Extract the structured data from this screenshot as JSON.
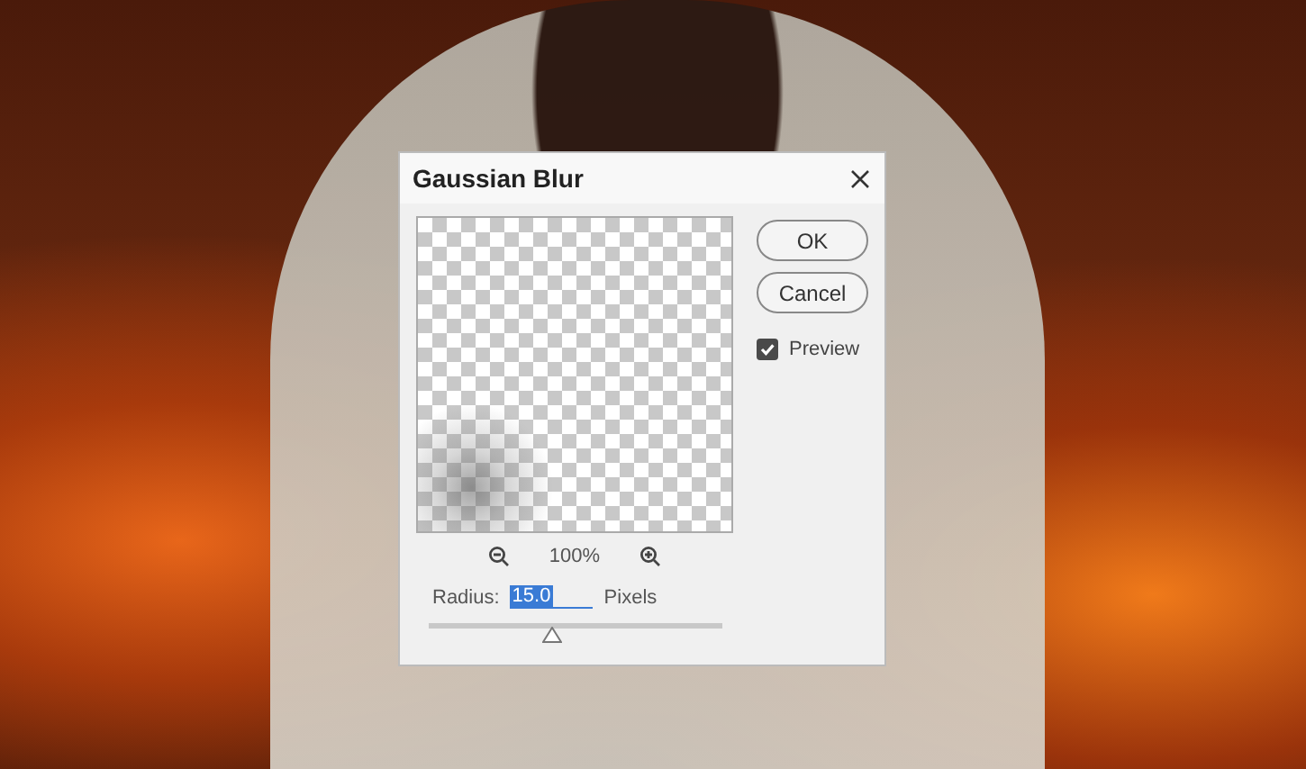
{
  "dialog": {
    "title": "Gaussian Blur",
    "buttons": [
      {
        "label": "OK"
      },
      {
        "label": "Cancel"
      }
    ],
    "preview_checkbox": {
      "label": "Preview",
      "checked": true
    },
    "zoom": {
      "percent": "100%"
    },
    "radius": {
      "label": "Radius:",
      "value": "15.0",
      "value_highlighted": true,
      "unit": "Pixels"
    },
    "slider": {
      "level": 0.42
    }
  }
}
